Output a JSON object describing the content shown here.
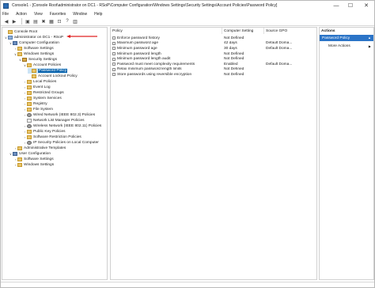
{
  "window": {
    "title": "Console1 - [Console Root\\administrator on DC1 - RSoP\\Computer Configuration\\Windows Settings\\Security Settings\\Account Policies\\Password Policy]",
    "minimize": "—",
    "maximize": "☐",
    "close": "✕"
  },
  "menu": [
    "File",
    "Action",
    "View",
    "Favorites",
    "Window",
    "Help"
  ],
  "toolbar": [
    "◀",
    "▶",
    "▣",
    "▤",
    "✖",
    "▦",
    "⊡",
    "?",
    "▥"
  ],
  "tree": {
    "items": [
      {
        "label": "Console Root",
        "level": 0,
        "chev": "",
        "icon": "folder"
      },
      {
        "label": "administrator on DC1 - RSoP",
        "level": 0,
        "chev": "∨",
        "icon": "policy"
      },
      {
        "label": "Computer Configuration",
        "level": 1,
        "chev": "∨",
        "icon": "pc"
      },
      {
        "label": "Software Settings",
        "level": 2,
        "chev": "›",
        "icon": "folder"
      },
      {
        "label": "Windows Settings",
        "level": 2,
        "chev": "∨",
        "icon": "folder"
      },
      {
        "label": "Security Settings",
        "level": 3,
        "chev": "∨",
        "icon": "sec"
      },
      {
        "label": "Account Policies",
        "level": 4,
        "chev": "∨",
        "icon": "folder"
      },
      {
        "label": "Password Policy",
        "level": 5,
        "chev": "",
        "icon": "folder",
        "selected": true
      },
      {
        "label": "Account Lockout Policy",
        "level": 5,
        "chev": "",
        "icon": "folder"
      },
      {
        "label": "Local Policies",
        "level": 4,
        "chev": "›",
        "icon": "folder"
      },
      {
        "label": "Event Log",
        "level": 4,
        "chev": "›",
        "icon": "folder"
      },
      {
        "label": "Restricted Groups",
        "level": 4,
        "chev": "›",
        "icon": "folder"
      },
      {
        "label": "System Services",
        "level": 4,
        "chev": "›",
        "icon": "folder"
      },
      {
        "label": "Registry",
        "level": 4,
        "chev": "›",
        "icon": "folder"
      },
      {
        "label": "File System",
        "level": 4,
        "chev": "›",
        "icon": "folder"
      },
      {
        "label": "Wired Network (IEEE 802.3) Policies",
        "level": 4,
        "chev": "›",
        "icon": "gear"
      },
      {
        "label": "Network List Manager Policies",
        "level": 4,
        "chev": "",
        "icon": "doc"
      },
      {
        "label": "Wireless Network (IEEE 802.11) Policies",
        "level": 4,
        "chev": "›",
        "icon": "gear"
      },
      {
        "label": "Public Key Policies",
        "level": 4,
        "chev": "›",
        "icon": "folder"
      },
      {
        "label": "Software Restriction Policies",
        "level": 4,
        "chev": "›",
        "icon": "folder"
      },
      {
        "label": "IP Security Policies on Local Computer",
        "level": 4,
        "chev": "›",
        "icon": "gear"
      },
      {
        "label": "Administrative Templates",
        "level": 2,
        "chev": "›",
        "icon": "folder"
      },
      {
        "label": "User Configuration",
        "level": 1,
        "chev": "∨",
        "icon": "pc"
      },
      {
        "label": "Software Settings",
        "level": 2,
        "chev": "›",
        "icon": "folder"
      },
      {
        "label": "Windows Settings",
        "level": 2,
        "chev": "›",
        "icon": "folder"
      }
    ]
  },
  "list": {
    "columns": [
      "Policy",
      "Computer Setting",
      "Source GPO"
    ],
    "rows": [
      {
        "policy": "Enforce password history",
        "setting": "Not Defined",
        "source": ""
      },
      {
        "policy": "Maximum password age",
        "setting": "42 days",
        "source": "Default Doma..."
      },
      {
        "policy": "Minimum password age",
        "setting": "30 days",
        "source": "Default Doma..."
      },
      {
        "policy": "Minimum password length",
        "setting": "Not Defined",
        "source": ""
      },
      {
        "policy": "Minimum password length audit",
        "setting": "Not Defined",
        "source": ""
      },
      {
        "policy": "Password must meet complexity requirements",
        "setting": "Enabled",
        "source": "Default Doma..."
      },
      {
        "policy": "Relax minimum password length limits",
        "setting": "Not Defined",
        "source": ""
      },
      {
        "policy": "Store passwords using reversible encryption",
        "setting": "Not Defined",
        "source": ""
      }
    ]
  },
  "actions": {
    "header": "Actions",
    "section_title": "Password Policy",
    "items": [
      "More Actions"
    ]
  }
}
